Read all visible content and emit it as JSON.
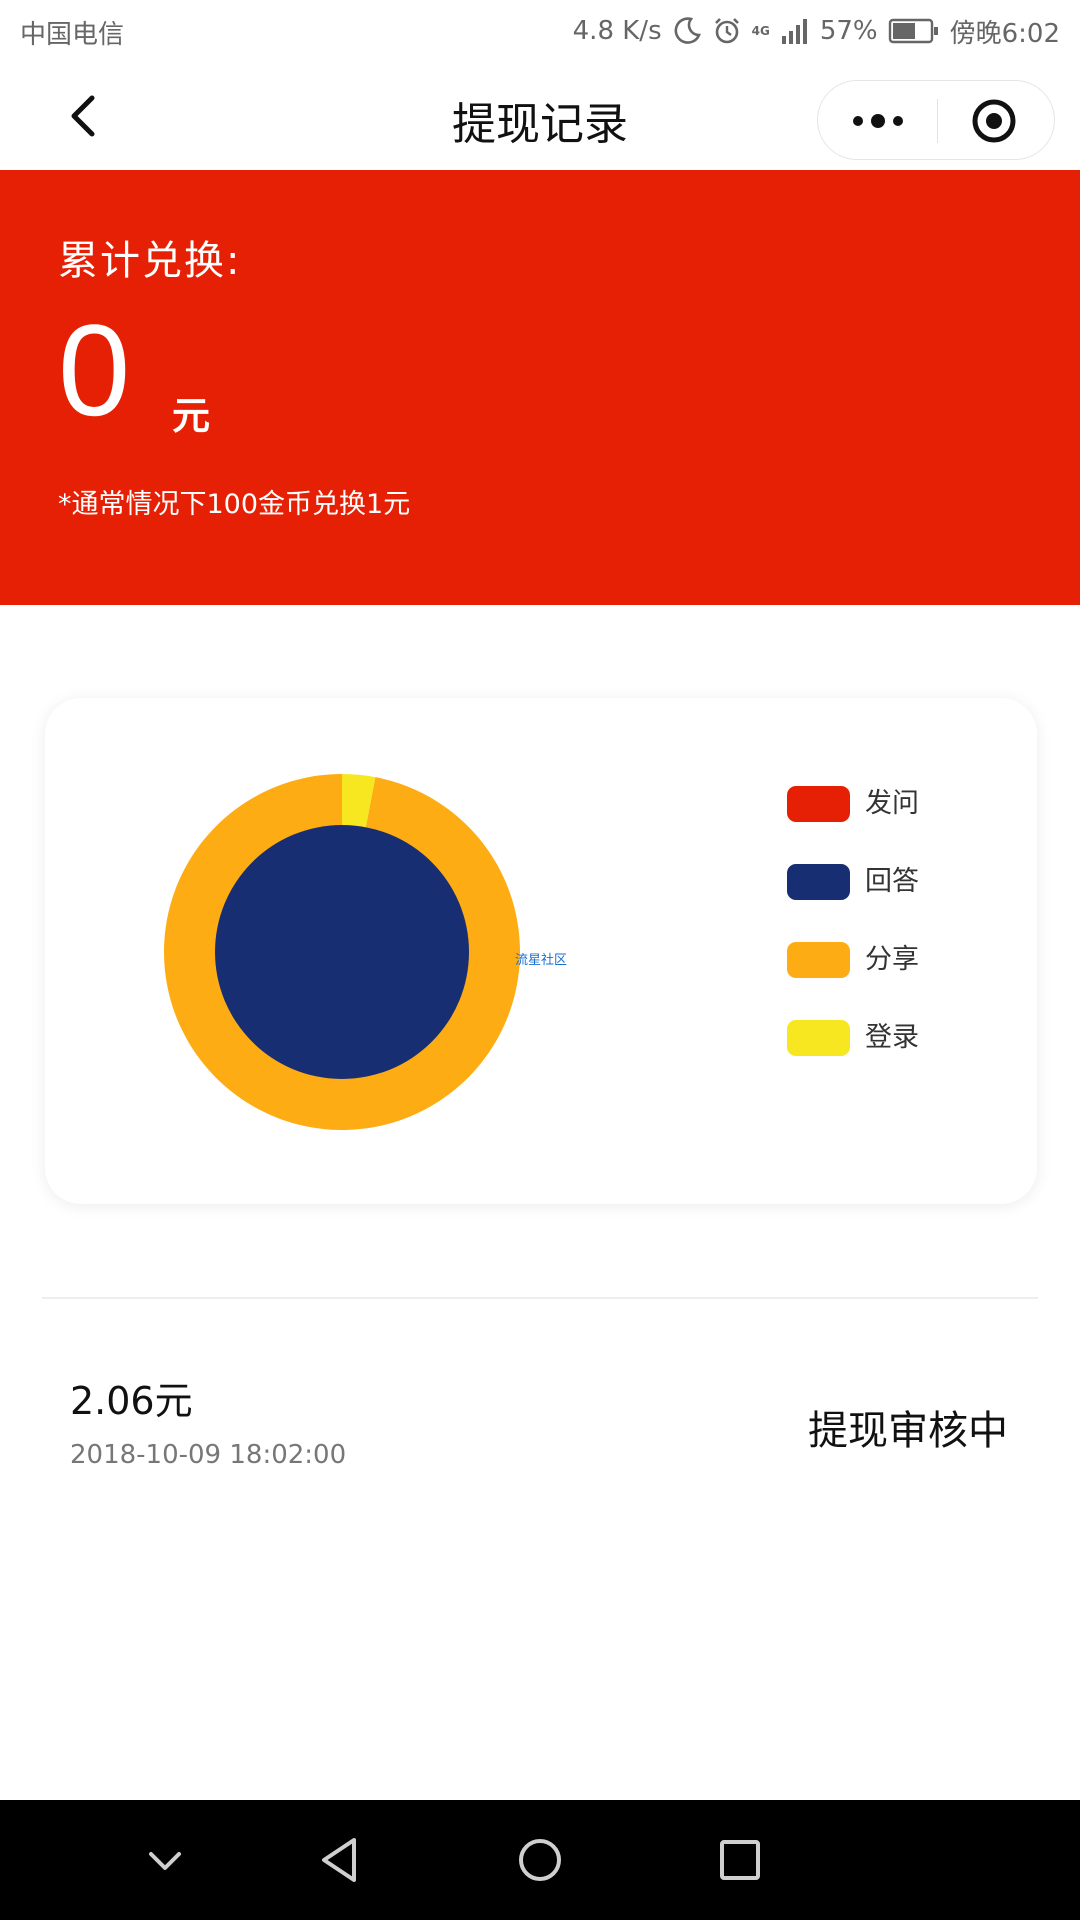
{
  "status_bar": {
    "carrier": "中国电信",
    "net_speed": "4.8 K/s",
    "network_type": "4G",
    "battery": "57%",
    "time": "傍晚6:02",
    "icons": [
      "moon-icon",
      "alarm-icon",
      "signal-icon",
      "battery-icon"
    ]
  },
  "nav": {
    "title": "提现记录",
    "back_icon": "chevron-left-icon",
    "more_icon": "more-dots-icon",
    "close_icon": "target-circle-icon"
  },
  "summary": {
    "label": "累计兑换:",
    "amount": "0",
    "unit": "元",
    "note": "*通常情况下100金币兑换1元",
    "background": "#e52004"
  },
  "chart_data": {
    "type": "pie",
    "categories": [
      "发问",
      "回答",
      "分享",
      "登录"
    ],
    "colors": [
      "#e52004",
      "#172e72",
      "#fdac13",
      "#f6e720"
    ],
    "inner_values": [
      0,
      1
    ],
    "outer_values": [
      0,
      0,
      97,
      3
    ],
    "legend": "right",
    "watermark": "流星社区"
  },
  "records": [
    {
      "amount": "2.06元",
      "time": "2018-10-09 18:02:00",
      "status": "提现审核中"
    }
  ],
  "android_nav": {
    "keys": [
      "chevron-down-icon",
      "back-triangle-icon",
      "home-circle-icon",
      "recent-square-icon"
    ]
  }
}
